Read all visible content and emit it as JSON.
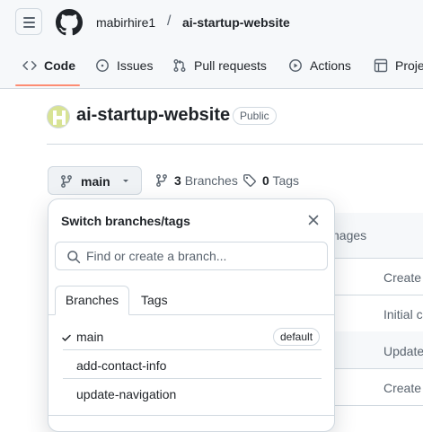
{
  "breadcrumb": {
    "owner": "mabirhire1",
    "separator": "/",
    "repo": "ai-startup-website"
  },
  "tabs": [
    {
      "label": "Code",
      "icon": "code-icon",
      "active": true
    },
    {
      "label": "Issues",
      "icon": "issue-icon"
    },
    {
      "label": "Pull requests",
      "icon": "pull-request-icon"
    },
    {
      "label": "Actions",
      "icon": "actions-icon"
    },
    {
      "label": "Proje",
      "icon": "project-icon"
    }
  ],
  "repo": {
    "title": "ai-startup-website",
    "visibility": "Public"
  },
  "branch_button": {
    "label": "main"
  },
  "counts": {
    "branches_count": "3",
    "branches_label": "Branches",
    "tags_count": "0",
    "tags_label": "Tags"
  },
  "file_table": {
    "header_fragment": "nages",
    "rows": [
      "Create",
      "Initial c",
      "Update",
      "Create"
    ]
  },
  "dropdown": {
    "title": "Switch branches/tags",
    "search_placeholder": "Find or create a branch...",
    "tabs": [
      "Branches",
      "Tags"
    ],
    "branches": [
      {
        "name": "main",
        "checked": true,
        "badge": "default"
      },
      {
        "name": "add-contact-info"
      },
      {
        "name": "update-navigation"
      }
    ]
  },
  "colors": {
    "accent_underline": "#fd8c73",
    "border": "#d1d9e0",
    "muted_text": "#59636e"
  }
}
